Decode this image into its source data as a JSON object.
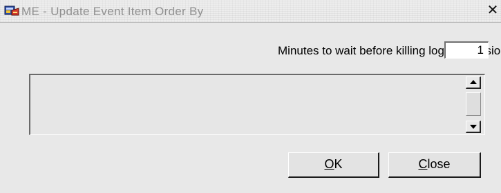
{
  "window": {
    "title": "ME - Update Event Item Order By",
    "app_icon": "oracle-forms-icon",
    "close_glyph": "✕"
  },
  "form": {
    "minutes_label": "Minutes to wait before killing logged sessions",
    "minutes_value": "1",
    "textarea_value": ""
  },
  "buttons": {
    "ok": {
      "mnemonic": "O",
      "rest": "K"
    },
    "close": {
      "mnemonic": "C",
      "rest": "lose"
    }
  }
}
